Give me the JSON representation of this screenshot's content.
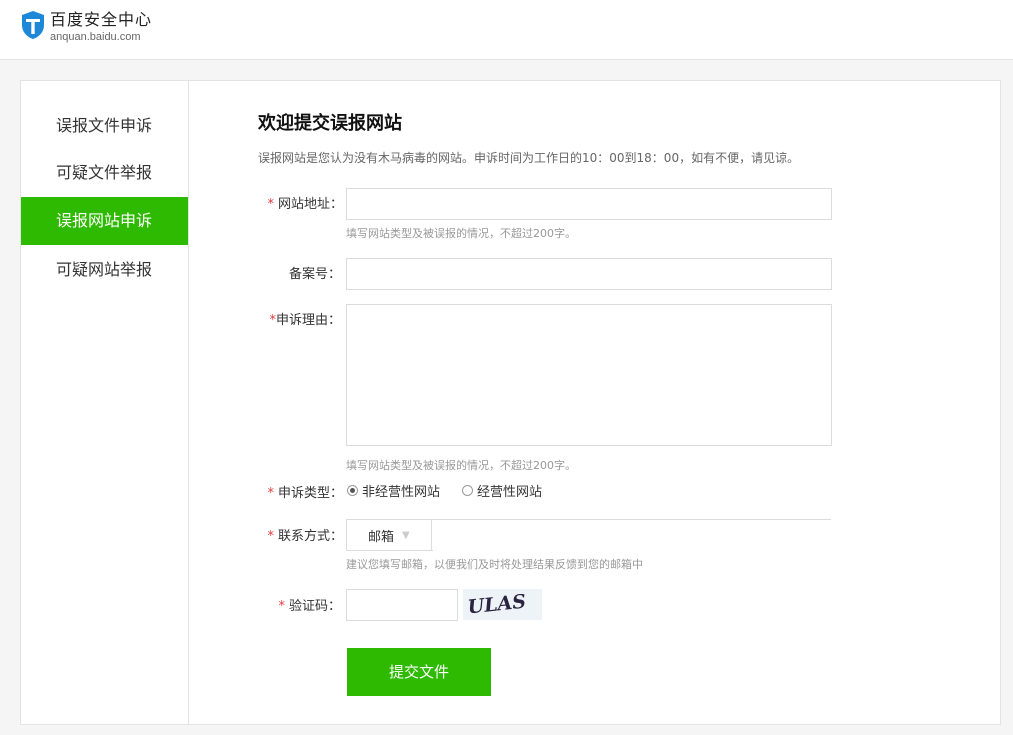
{
  "brand": {
    "title": "百度安全中心",
    "subtitle": "anquan.baidu.com"
  },
  "sidebar": {
    "items": [
      {
        "label": "误报文件申诉",
        "active": false
      },
      {
        "label": "可疑文件举报",
        "active": false
      },
      {
        "label": "误报网站申诉",
        "active": true
      },
      {
        "label": "可疑网站举报",
        "active": false
      }
    ]
  },
  "form": {
    "title": "欢迎提交误报网站",
    "description": "误报网站是您认为没有木马病毒的网站。申诉时间为工作日的10：00到18：00，如有不便，请见谅。",
    "required_mark": "*",
    "fields": {
      "site_url": {
        "label": "网站地址：",
        "value": "",
        "hint": "填写网站类型及被误报的情况，不超过200字。"
      },
      "icp": {
        "label": "备案号：",
        "value": ""
      },
      "reason": {
        "label": "申诉理由：",
        "value": "",
        "hint": "填写网站类型及被误报的情况，不超过200字。"
      },
      "type": {
        "label": "申诉类型：",
        "options": [
          {
            "label": "非经营性网站",
            "checked": true
          },
          {
            "label": "经营性网站",
            "checked": false
          }
        ]
      },
      "contact": {
        "label": "联系方式：",
        "selected": "邮箱",
        "value": "",
        "hint": "建议您填写邮箱，以便我们及时将处理结果反馈到您的邮箱中"
      },
      "captcha": {
        "label": "验证码：",
        "value": "",
        "image_text": "ULAS"
      }
    },
    "submit_label": "提交文件"
  },
  "colors": {
    "accent": "#2eba00",
    "required": "#e4393c",
    "brand_blue": "#1e88d8"
  }
}
